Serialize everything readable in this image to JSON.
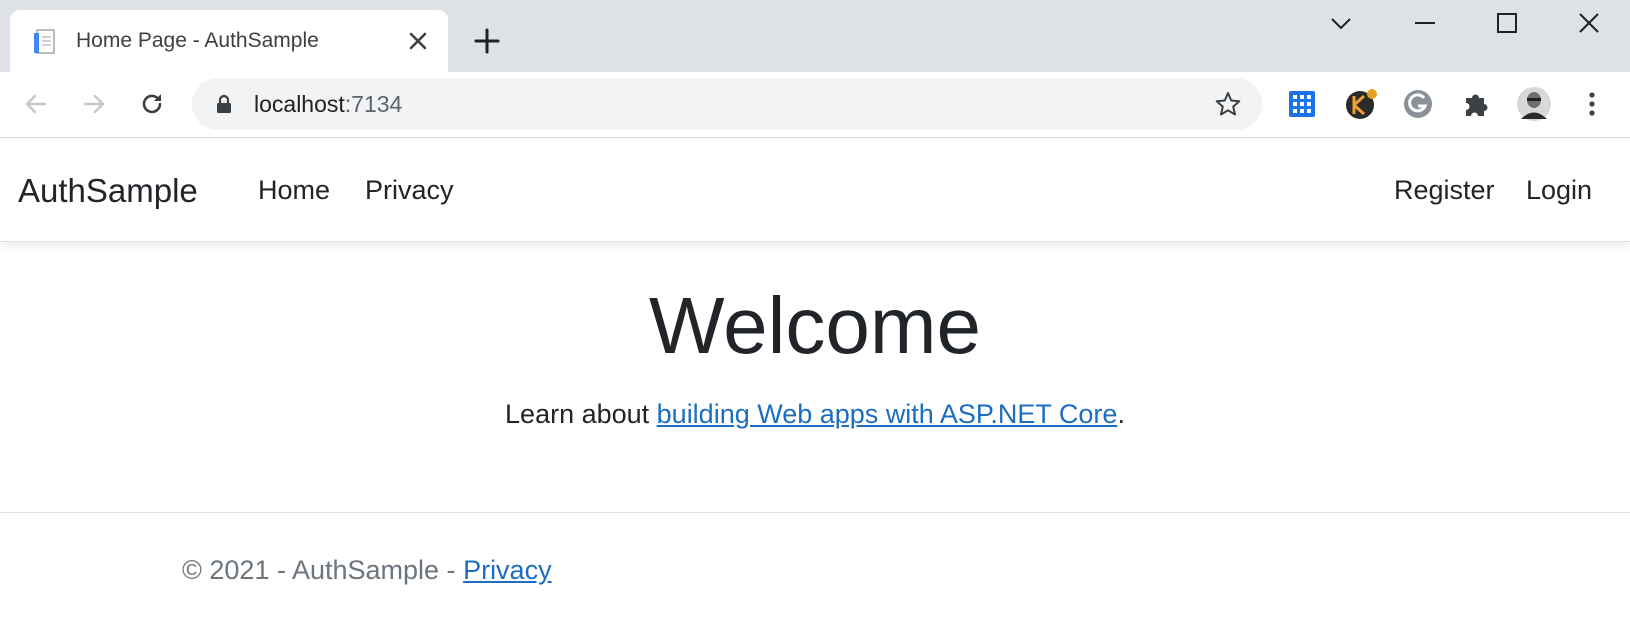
{
  "browser": {
    "tab": {
      "title": "Home Page - AuthSample"
    },
    "address_bar": {
      "host": "localhost",
      "port": ":7134"
    },
    "window_controls": [
      "tab-search",
      "minimize",
      "maximize",
      "close"
    ],
    "extensions": [
      "apps-grid-icon",
      "keeper-extension-icon",
      "grammarly-icon",
      "puzzle-extensions-icon",
      "profile-avatar",
      "kebab-menu-icon"
    ]
  },
  "navbar": {
    "brand": "AuthSample",
    "links": [
      {
        "label": "Home"
      },
      {
        "label": "Privacy"
      }
    ],
    "right_links": [
      {
        "label": "Register"
      },
      {
        "label": "Login"
      }
    ]
  },
  "main": {
    "heading": "Welcome",
    "learn_prefix": "Learn about ",
    "learn_link": "building Web apps with ASP.NET Core",
    "learn_suffix": "."
  },
  "footer": {
    "text": "© 2021 - AuthSample - ",
    "privacy_link": "Privacy"
  },
  "colors": {
    "link": "#1b6ec2",
    "tabstrip": "#dee1e6",
    "omnibox": "#f1f3f4",
    "text": "#212529",
    "footer_text": "#6c757d"
  }
}
